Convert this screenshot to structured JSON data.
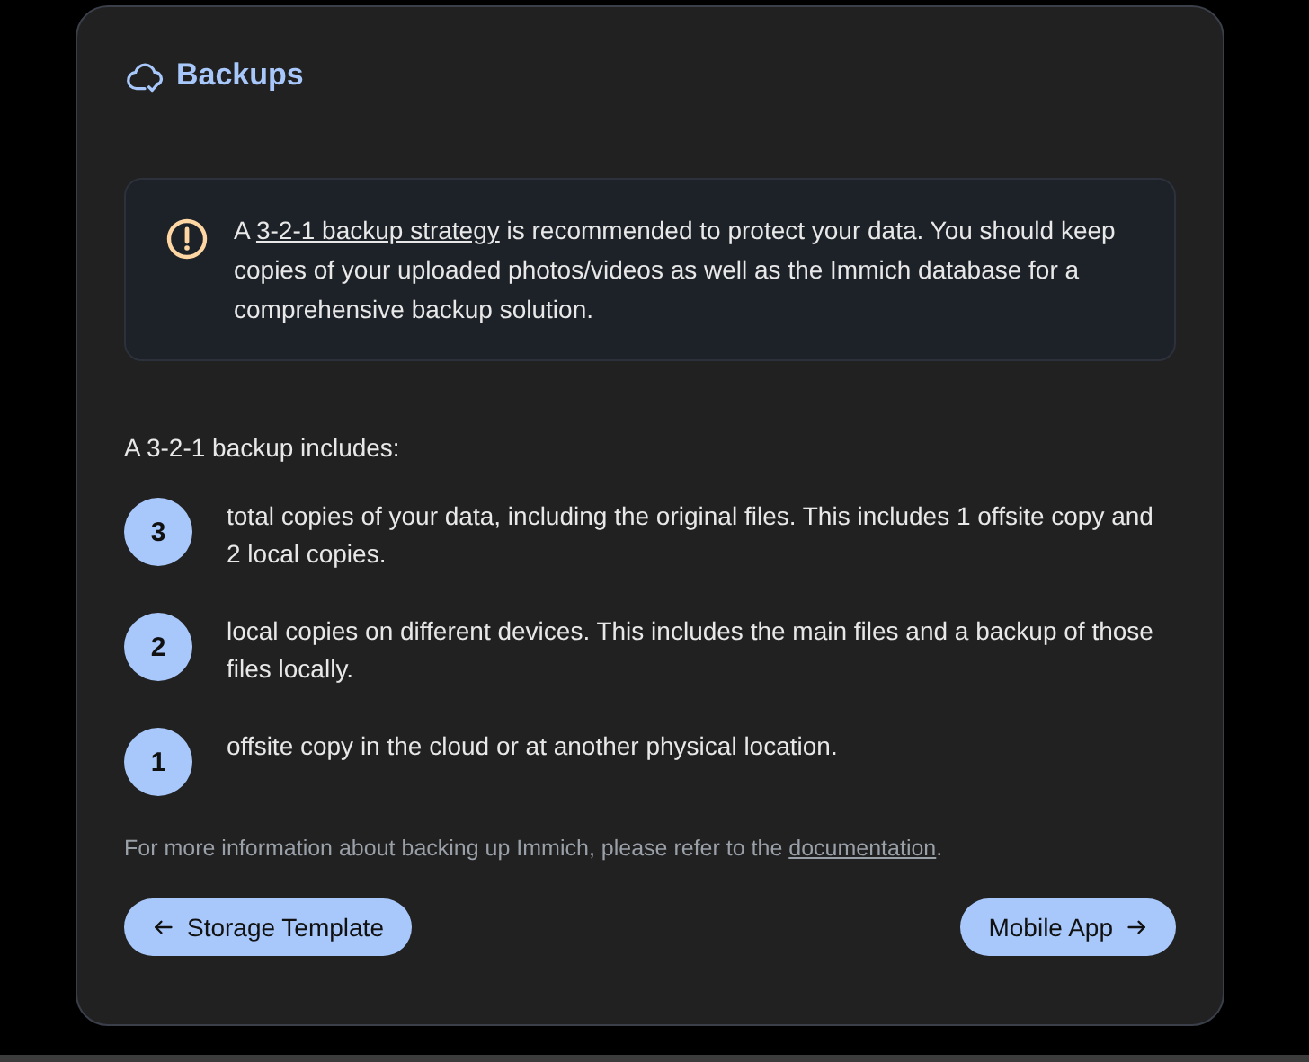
{
  "title": "Backups",
  "alert": {
    "before": "A ",
    "link": "3-2-1 backup strategy",
    "after": " is recommended to protect your data. You should keep copies of your uploaded photos/videos as well as the Immich database for a comprehensive backup solution."
  },
  "intro": "A 3-2-1 backup includes:",
  "steps": [
    {
      "number": "3",
      "text": "total copies of your data, including the original files. This includes 1 offsite copy and 2 local copies."
    },
    {
      "number": "2",
      "text": "local copies on different devices. This includes the main files and a backup of those files locally."
    },
    {
      "number": "1",
      "text": "offsite copy in the cloud or at another physical location."
    }
  ],
  "note": {
    "before": "For more information about backing up Immich, please refer to the ",
    "link": "documentation",
    "after": "."
  },
  "buttons": [
    {
      "label": "Storage Template",
      "kind": "back"
    },
    {
      "label": "Mobile App",
      "kind": "next"
    }
  ]
}
